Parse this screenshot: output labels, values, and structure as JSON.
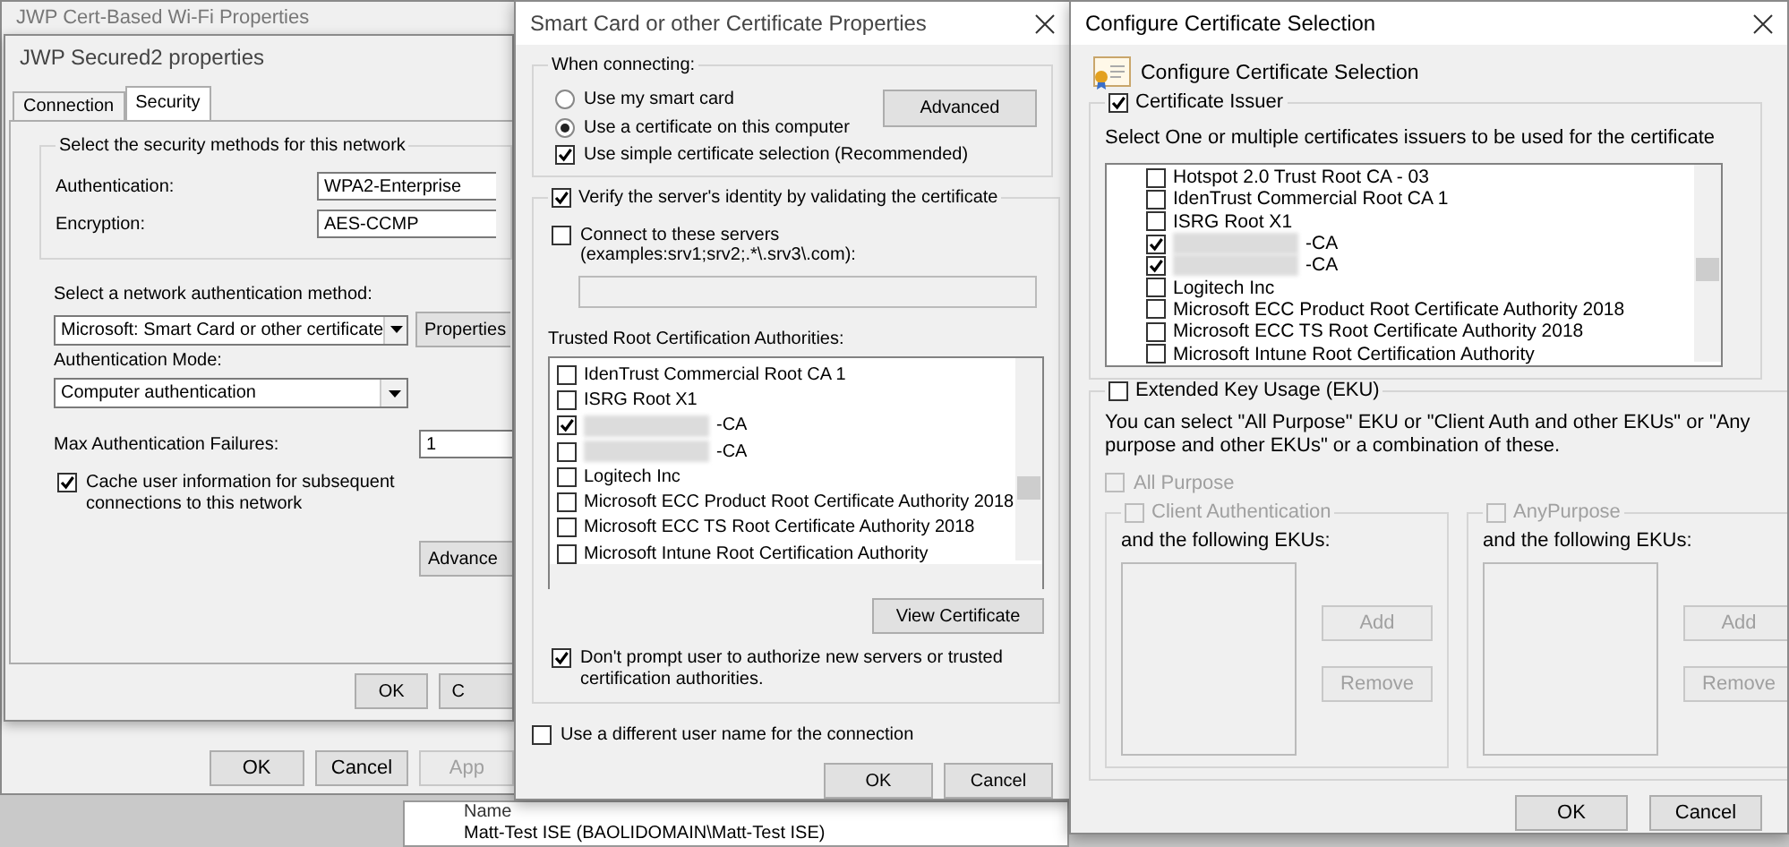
{
  "background_window": {
    "title": "JWP Cert-Based Wi-Fi Properties",
    "buttons": [
      {
        "label": "OK",
        "disabled": false
      },
      {
        "label": "Cancel",
        "disabled": false
      },
      {
        "label": "App",
        "disabled": true
      }
    ]
  },
  "background_list": {
    "column_1": "Name",
    "rows": [
      "Matt-Test ISE (BAOLIDOMAIN\\Matt-Test ISE)"
    ]
  },
  "network_properties": {
    "title": "JWP Secured2 properties",
    "tabs": [
      {
        "label": "Connection",
        "selected": false
      },
      {
        "label": "Security",
        "selected": true
      }
    ],
    "security_group": {
      "legend": "Select the security methods for this network",
      "fields": [
        {
          "label": "Authentication:",
          "value": "WPA2-Enterprise"
        },
        {
          "label": "Encryption:",
          "value": "AES-CCMP"
        }
      ]
    },
    "method_label": "Select a network authentication method:",
    "method_value": "Microsoft: Smart Card or other certificate",
    "properties_button": "Properties",
    "mode_label": "Authentication Mode:",
    "mode_value": "Computer authentication",
    "max_failures_label": "Max Authentication Failures:",
    "max_failures_value": "1",
    "cache": {
      "label": "Cache user information for subsequent connections to this network",
      "checked": true
    },
    "advanced_button": "Advance",
    "buttons": [
      "OK",
      "C"
    ]
  },
  "smart_card_properties": {
    "title": "Smart Card or other Certificate Properties",
    "when_connecting": {
      "legend": "When connecting:",
      "options": [
        {
          "label": "Use my smart card",
          "selected": false
        },
        {
          "label": "Use a certificate on this computer",
          "selected": true
        }
      ],
      "advanced_button": "Advanced",
      "simple_selection": {
        "label": "Use simple certificate selection (Recommended)",
        "checked": true
      }
    },
    "verify": {
      "label": "Verify the server's identity by validating the certificate",
      "checked": true
    },
    "connect_servers": {
      "label": "Connect to these servers (examples:srv1;srv2;.*\\.srv3\\.com):",
      "checked": false
    },
    "trusted_label": "Trusted Root Certification Authorities:",
    "authorities": [
      {
        "name": "IdenTrust Commercial Root CA 1",
        "redacted": false,
        "checked": false
      },
      {
        "name": "ISRG Root X1",
        "redacted": false,
        "checked": false
      },
      {
        "name": "-CA",
        "redacted": true,
        "checked": true
      },
      {
        "name": "-CA",
        "redacted": true,
        "checked": false
      },
      {
        "name": "Logitech Inc",
        "redacted": false,
        "checked": false
      },
      {
        "name": "Microsoft ECC Product Root Certificate Authority 2018",
        "redacted": false,
        "checked": false
      },
      {
        "name": "Microsoft ECC TS Root Certificate Authority 2018",
        "redacted": false,
        "checked": false
      },
      {
        "name": "Microsoft Intune Root Certification Authority",
        "redacted": false,
        "checked": false
      }
    ],
    "view_button": "View Certificate",
    "dont_prompt": {
      "label": "Don't prompt user to authorize new servers or trusted certification authorities.",
      "checked": true
    },
    "different_user": {
      "label": "Use a different user name for the connection",
      "checked": false
    },
    "buttons": [
      "OK",
      "Cancel"
    ]
  },
  "certificate_selection": {
    "title": "Configure Certificate Selection",
    "header": "Configure Certificate Selection",
    "issuer": {
      "label": "Certificate Issuer",
      "checked": true
    },
    "issuer_hint": "Select One or multiple certificates issuers to be used for the certificate",
    "issuers": [
      {
        "name": "Hotspot 2.0 Trust Root CA - 03",
        "redacted": false,
        "checked": false
      },
      {
        "name": "IdenTrust Commercial Root CA 1",
        "redacted": false,
        "checked": false
      },
      {
        "name": "ISRG Root X1",
        "redacted": false,
        "checked": false
      },
      {
        "name": "-CA",
        "redacted": true,
        "checked": true
      },
      {
        "name": "-CA",
        "redacted": true,
        "checked": true
      },
      {
        "name": "Logitech Inc",
        "redacted": false,
        "checked": false
      },
      {
        "name": "Microsoft ECC Product Root Certificate Authority 2018",
        "redacted": false,
        "checked": false
      },
      {
        "name": "Microsoft ECC TS Root Certificate Authority 2018",
        "redacted": false,
        "checked": false
      },
      {
        "name": "Microsoft Intune Root Certification Authority",
        "redacted": false,
        "checked": false
      }
    ],
    "eku": {
      "label": "Extended Key Usage (EKU)",
      "checked": false
    },
    "eku_hint": "You can select \"All Purpose\" EKU or \"Client Auth and other EKUs\" or \"Any purpose and other EKUs\" or a combination of these.",
    "all_purpose": {
      "label": "All Purpose",
      "checked": false,
      "disabled": true
    },
    "eku_groups": [
      {
        "label": "Client Authentication",
        "checked": false,
        "disabled": true,
        "sublabel": "and the following EKUs:",
        "buttons": [
          "Add",
          "Remove"
        ]
      },
      {
        "label": "AnyPurpose",
        "checked": false,
        "disabled": true,
        "sublabel": "and the following EKUs:",
        "buttons": [
          "Add",
          "Remove"
        ]
      }
    ],
    "buttons": [
      "OK",
      "Cancel"
    ]
  }
}
